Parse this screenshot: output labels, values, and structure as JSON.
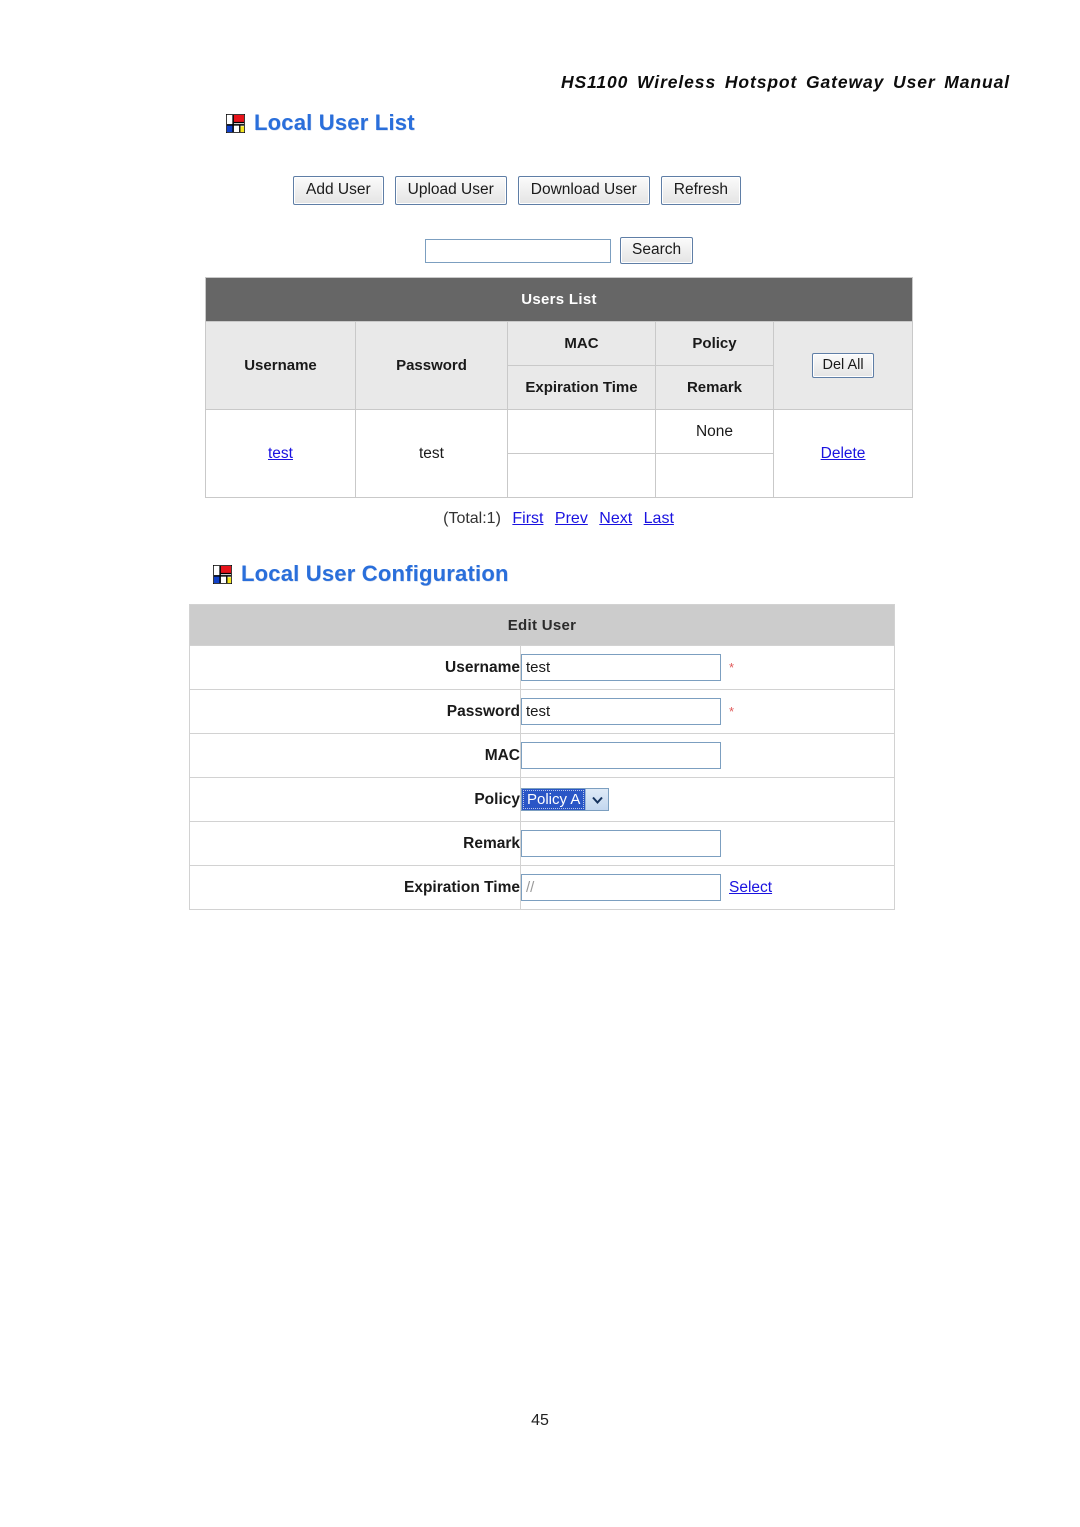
{
  "document": {
    "running_header": "HS1100 Wireless Hotspot Gateway User Manual",
    "page_number": "45"
  },
  "colors": {
    "heading_blue": "#2a6fdb",
    "link_blue": "#1a12e0",
    "users_list_bar": "#666666",
    "edit_user_bar": "#cccccc",
    "required_star": "#e05a5a",
    "select_highlight": "#2a56c6"
  },
  "user_list_section": {
    "heading": "Local User List",
    "icon": "mondrian-icon",
    "buttons": [
      {
        "label": "Add User",
        "name": "add-user-button"
      },
      {
        "label": "Upload User",
        "name": "upload-user-button"
      },
      {
        "label": "Download User",
        "name": "download-user-button"
      },
      {
        "label": "Refresh",
        "name": "refresh-button"
      }
    ],
    "search": {
      "value": "",
      "placeholder": "",
      "button_label": "Search"
    },
    "table": {
      "title": "Users List",
      "headers": {
        "username": "Username",
        "password": "Password",
        "mac": "MAC",
        "policy": "Policy",
        "expiration_time": "Expiration Time",
        "remark": "Remark",
        "del_all": "Del All"
      },
      "rows": [
        {
          "username": "test",
          "password": "test",
          "mac": "",
          "policy": "None",
          "expiration_time": "",
          "remark": "",
          "action": "Delete"
        }
      ]
    },
    "pagination": {
      "total": "(Total:1)",
      "first": "First",
      "prev": "Prev",
      "next": "Next",
      "last": "Last"
    }
  },
  "user_config_section": {
    "heading": "Local User Configuration",
    "icon": "mondrian-icon",
    "table": {
      "title": "Edit User",
      "fields": [
        {
          "label": "Username",
          "value": "test",
          "required": "*"
        },
        {
          "label": "Password",
          "value": "test",
          "required": "*"
        },
        {
          "label": "MAC",
          "value": "",
          "required": ""
        },
        {
          "label": "Policy",
          "value": "Policy A",
          "required": ""
        },
        {
          "label": "Remark",
          "value": "",
          "required": ""
        },
        {
          "label": "Expiration Time",
          "value": "//",
          "required": ""
        }
      ],
      "policy_options": [
        "Policy A"
      ],
      "expiration_select_link": "Select"
    }
  }
}
